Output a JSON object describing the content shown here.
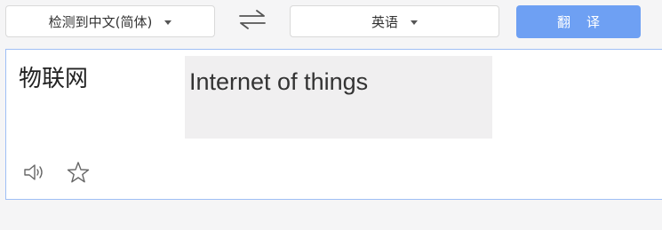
{
  "toolbar": {
    "source_language": "检测到中文(简体)",
    "target_language": "英语",
    "translate_label": "翻译"
  },
  "content": {
    "source_text": "物联网",
    "translation": "Internet of things"
  },
  "icons": {
    "source_dropdown": "chevron-down-icon",
    "target_dropdown": "chevron-down-icon",
    "swap": "swap-arrows-icon",
    "speak": "speaker-icon",
    "favorite": "star-icon"
  },
  "colors": {
    "accent": "#6ea0f3",
    "border": "#9fbff5",
    "highlight": "#f0eff0"
  }
}
